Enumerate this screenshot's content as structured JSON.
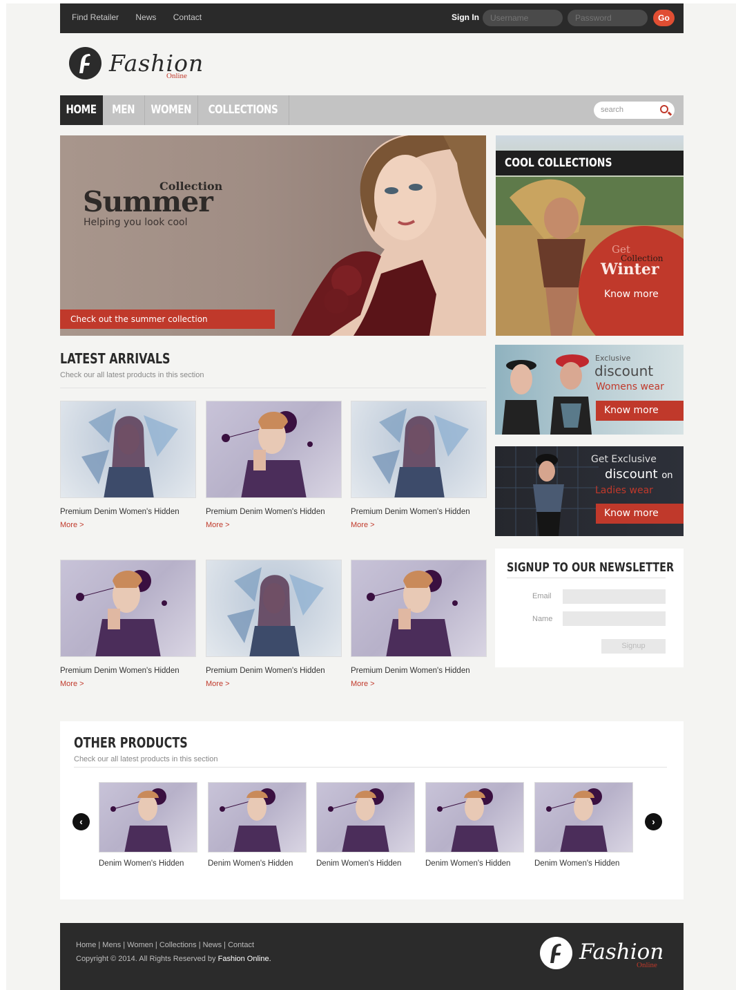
{
  "topbar": {
    "links": [
      "Find Retailer",
      "News",
      "Contact"
    ],
    "signin_label": "Sign In",
    "username_placeholder": "Username",
    "password_placeholder": "Password",
    "go_label": "Go"
  },
  "logo": {
    "word": "Fashion",
    "sub": "Online"
  },
  "nav": {
    "items": [
      "HOME",
      "MEN",
      "WOMEN",
      "COLLECTIONS"
    ],
    "search_placeholder": "search"
  },
  "hero": {
    "collection": "Collection",
    "title": "Summer",
    "tagline": "Helping you look cool",
    "cta": "Check out the summer collection"
  },
  "cool": {
    "heading": "COOL COLLECTIONS",
    "get": "Get",
    "collection": "Collection",
    "winter": "Winter",
    "know_more": "Know more"
  },
  "promo1": {
    "line1": "Exclusive",
    "line2": "discount",
    "line3": "Womens wear",
    "cta": "Know more"
  },
  "promo2": {
    "line1": "Get Exclusive",
    "line2": "discount",
    "line2b": "on",
    "line3": "Ladies wear",
    "cta": "Know more"
  },
  "latest": {
    "title": "LATEST ARRIVALS",
    "subtitle": "Check our all latest products in this section",
    "products": [
      {
        "name": "Premium Denim Women's Hidden",
        "more": "More >"
      },
      {
        "name": "Premium Denim Women's Hidden",
        "more": "More >"
      },
      {
        "name": "Premium Denim Women's Hidden",
        "more": "More >"
      },
      {
        "name": "Premium Denim Women's Hidden",
        "more": "More >"
      },
      {
        "name": "Premium Denim Women's Hidden",
        "more": "More >"
      },
      {
        "name": "Premium Denim Women's Hidden",
        "more": "More >"
      }
    ]
  },
  "newsletter": {
    "title": "SIGNUP TO OUR NEWSLETTER",
    "email_label": "Email",
    "name_label": "Name",
    "signup_label": "Signup"
  },
  "other": {
    "title": "OTHER PRODUCTS",
    "subtitle": "Check our all latest products in this section",
    "products": [
      "Denim Women's Hidden",
      "Denim Women's Hidden",
      "Denim Women's Hidden",
      "Denim Women's Hidden",
      "Denim Women's Hidden"
    ]
  },
  "footer": {
    "links": "Home | Mens | Women | Collections | News | Contact",
    "copyright": "Copyright © 2014. All Rights Reserved by",
    "brand": "Fashion Online.",
    "logo_word": "Fashion",
    "logo_sub": "Online"
  },
  "colors": {
    "accent": "#c0392b",
    "dark": "#2a2a2a",
    "nav": "#c3c3c3",
    "page_bg": "#f4f4f2"
  }
}
